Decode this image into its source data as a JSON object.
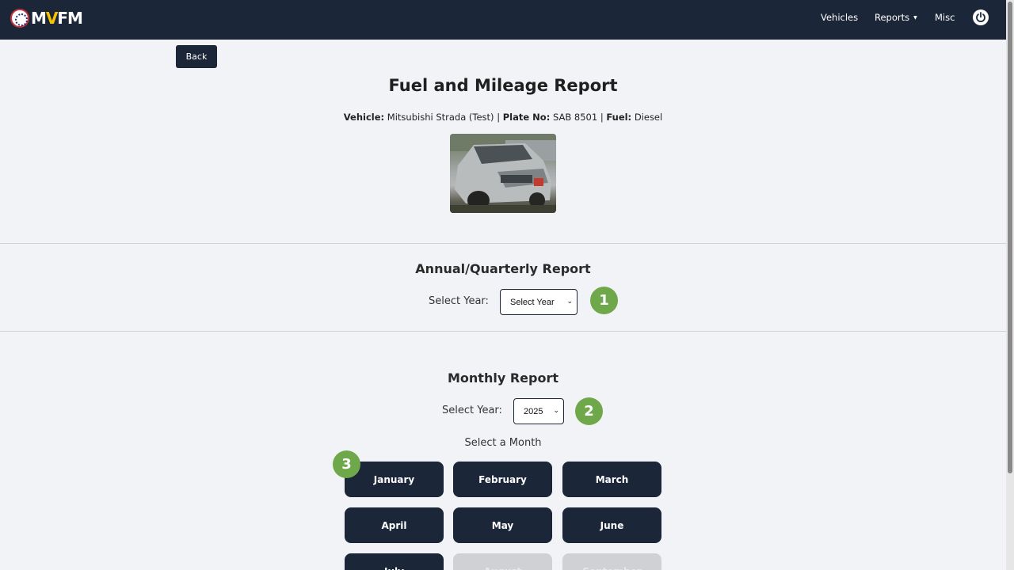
{
  "nav": {
    "logo_prefix": "M",
    "logo_v": "V",
    "logo_suffix": "FM",
    "items": [
      {
        "label": "Vehicles"
      },
      {
        "label": "Reports"
      },
      {
        "label": "Misc"
      }
    ],
    "power_icon": "power-icon"
  },
  "back_label": "Back",
  "page_title": "Fuel and Mileage Report",
  "vehicle": {
    "vehicle_label": "Vehicle:",
    "vehicle_value": "Mitsubishi Strada (Test)",
    "plate_label": "Plate No:",
    "plate_value": "SAB 8501",
    "fuel_label": "Fuel:",
    "fuel_value": "Diesel",
    "separator": "|"
  },
  "annual": {
    "title": "Annual/Quarterly Report",
    "year_label": "Select Year:",
    "year_value": "Select Year"
  },
  "monthly": {
    "title": "Monthly Report",
    "year_label": "Select Year:",
    "year_value": "2025",
    "month_prompt": "Select a Month",
    "months": [
      {
        "label": "January",
        "enabled": true
      },
      {
        "label": "February",
        "enabled": true
      },
      {
        "label": "March",
        "enabled": true
      },
      {
        "label": "April",
        "enabled": true
      },
      {
        "label": "May",
        "enabled": true
      },
      {
        "label": "June",
        "enabled": true
      },
      {
        "label": "July",
        "enabled": true
      },
      {
        "label": "August",
        "enabled": false
      },
      {
        "label": "September",
        "enabled": false
      }
    ]
  },
  "markers": [
    "1",
    "2",
    "3"
  ],
  "colors": {
    "navbar": "#1c2639",
    "accent_marker": "#6fa84a",
    "logo_v": "#f5c400",
    "disabled_button": "#cfd1d4"
  }
}
